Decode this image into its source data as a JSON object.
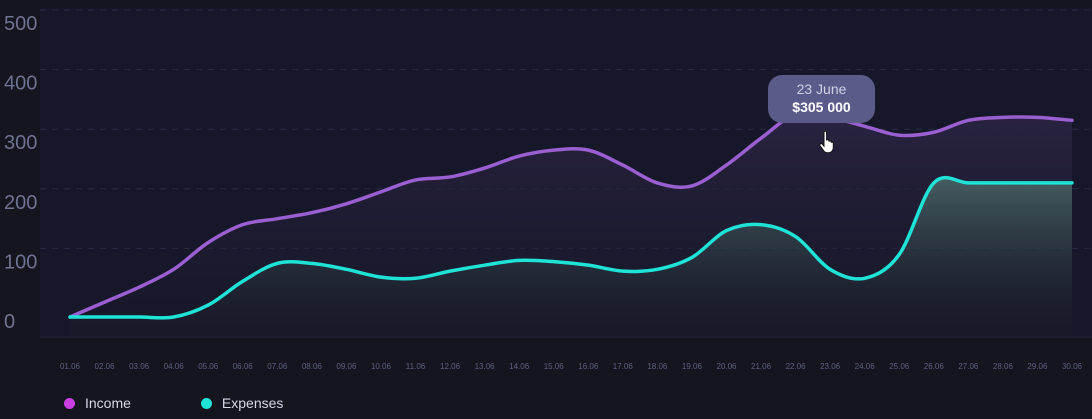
{
  "chart_data": {
    "type": "area",
    "categories": [
      "01.06",
      "02.06",
      "03.06",
      "04.06",
      "05.06",
      "06.06",
      "07.06",
      "08.06",
      "09.06",
      "10.06",
      "11.06",
      "12.06",
      "13.06",
      "14.06",
      "15.06",
      "16.06",
      "17.06",
      "18.06",
      "19.06",
      "20.06",
      "21.06",
      "22.06",
      "23.06",
      "24.06",
      "25.06",
      "26.06",
      "27.06",
      "28.06",
      "29.06",
      "30.06"
    ],
    "series": [
      {
        "name": "Income",
        "color": "#9a5fd1",
        "values": [
          5,
          30,
          55,
          85,
          130,
          160,
          170,
          180,
          195,
          215,
          235,
          240,
          255,
          275,
          285,
          285,
          260,
          230,
          225,
          260,
          305,
          345,
          340,
          325,
          310,
          315,
          335,
          340,
          340,
          335
        ]
      },
      {
        "name": "Expenses",
        "color": "#1ee3d6",
        "values": [
          5,
          5,
          5,
          5,
          25,
          65,
          95,
          95,
          85,
          72,
          70,
          82,
          92,
          100,
          98,
          92,
          82,
          85,
          105,
          150,
          160,
          140,
          85,
          70,
          110,
          230,
          230,
          230,
          230,
          230
        ]
      }
    ],
    "ylim": [
      0,
      500
    ],
    "yticks": [
      "0",
      "100",
      "200",
      "300",
      "400",
      "500"
    ],
    "grid": true,
    "legend_position": "bottom-left",
    "tooltip": {
      "date": "23 June",
      "value": "$305 000"
    }
  },
  "legend": [
    {
      "label": "Income",
      "color": "#c93fe0"
    },
    {
      "label": "Expenses",
      "color": "#1ee3d6"
    }
  ],
  "cursor_icon": "pointer-hand-icon"
}
